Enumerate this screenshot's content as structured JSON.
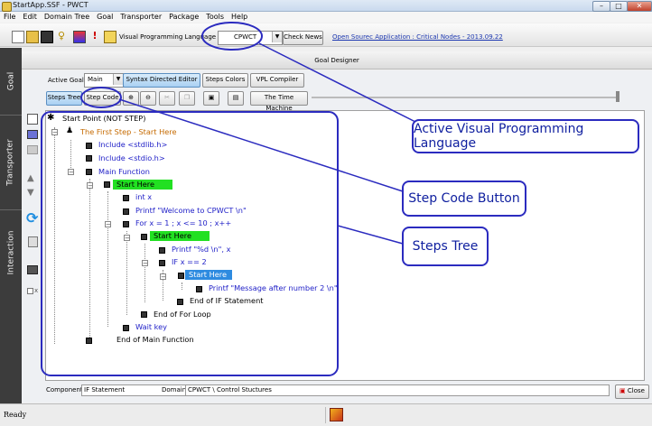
{
  "window": {
    "title": "StartApp.SSF - PWCT"
  },
  "menu": [
    "File",
    "Edit",
    "Domain Tree",
    "Goal",
    "Transporter",
    "Package",
    "Tools",
    "Help"
  ],
  "toolbar": {
    "vpl_label": "Visual Programming Language",
    "vpl_value": "CPWCT",
    "check_news": "Check News",
    "news_link": "Open Sourec Application : Critical Nodes - 2013.09.22"
  },
  "side_tabs": [
    "Goal",
    "Transporter",
    "Interaction"
  ],
  "goal_designer": {
    "title": "Goal Designer",
    "active_goal_label": "Active Goal :",
    "active_goal_value": "Main",
    "syntax_editor": "Syntax Directed Editor",
    "steps_colors": "Steps Colors",
    "vpl_compiler": "VPL Compiler",
    "steps_tree": "Steps Tree",
    "step_code": "Step Code",
    "time_machine": "The Time Machine"
  },
  "tree": [
    {
      "text": "Start Point (NOT STEP)",
      "style": "blk"
    },
    {
      "text": "The First Step  - Start Here",
      "style": "orange"
    },
    {
      "text": "Include <stdlib.h>",
      "style": "blue"
    },
    {
      "text": "Include <stdio.h>",
      "style": "blue"
    },
    {
      "text": "Main Function",
      "style": "blue"
    },
    {
      "text": "Start Here",
      "style": "green"
    },
    {
      "text": "int x",
      "style": "blue"
    },
    {
      "text": "Printf \"Welcome to CPWCT \\n\"",
      "style": "blue"
    },
    {
      "text": "For x = 1 ; x <= 10 ; x++",
      "style": "blue"
    },
    {
      "text": "Start Here",
      "style": "green"
    },
    {
      "text": "Printf \"%d  \\n\", x",
      "style": "blue"
    },
    {
      "text": "IF x == 2",
      "style": "blue"
    },
    {
      "text": "Start Here",
      "style": "sel"
    },
    {
      "text": "Printf \"Message after number 2  \\n\"",
      "style": "blue"
    },
    {
      "text": "End of IF Statement",
      "style": "blk"
    },
    {
      "text": "End of For Loop",
      "style": "blk"
    },
    {
      "text": "Wait key",
      "style": "blue"
    },
    {
      "text": "End of Main Function",
      "style": "blk"
    }
  ],
  "callouts": {
    "vpl": "Active Visual Programming Language",
    "step_code": "Step Code Button",
    "steps_tree": "Steps Tree"
  },
  "bottom": {
    "component_label": "Component",
    "component_value": "IF Statement",
    "domain_label": "Domain",
    "domain_value": "CPWCT \\ Control Stuctures",
    "close": "Close"
  },
  "status": {
    "text": "Ready"
  },
  "colors": {
    "callout": "#2b2bbf",
    "green": "#22e022",
    "selected": "#2e8be0"
  }
}
